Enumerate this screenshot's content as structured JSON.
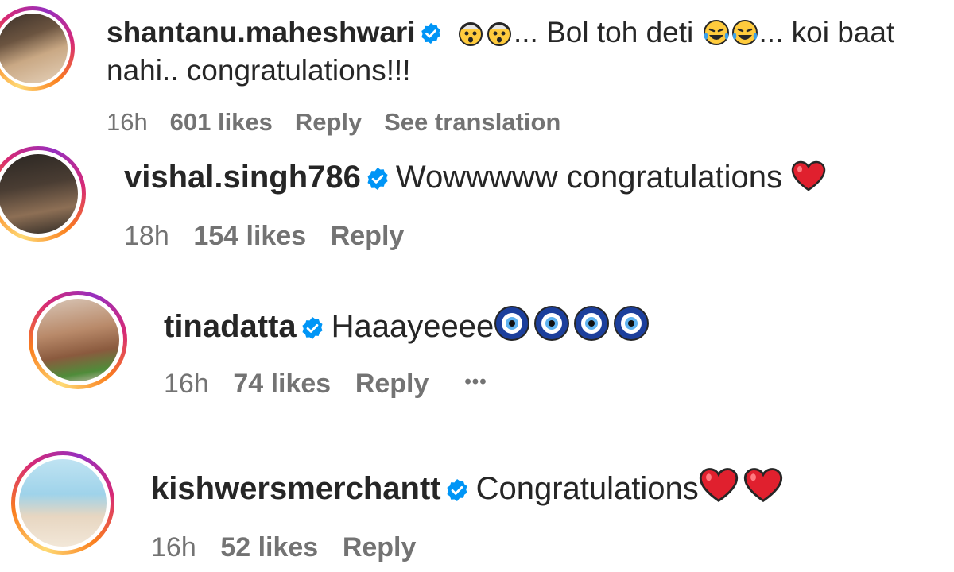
{
  "comments": [
    {
      "username": "shantanu.maheshwari",
      "text_parts": [
        "... Bol toh deti ",
        "... koi baat"
      ],
      "text_line2": "nahi.. congratulations!!!",
      "time": "16h",
      "likes": "601 likes",
      "reply": "Reply",
      "translate": "See translation"
    },
    {
      "username": "vishal.singh786",
      "text": "Wowwwww congratulations ",
      "time": "18h",
      "likes": "154 likes",
      "reply": "Reply"
    },
    {
      "username": "tinadatta",
      "text": "Haaayeeee",
      "time": "16h",
      "likes": "74 likes",
      "reply": "Reply",
      "more": "•••"
    },
    {
      "username": "kishwersmerchantt",
      "text": "Congratulations",
      "time": "16h",
      "likes": "52 likes",
      "reply": "Reply"
    }
  ],
  "icons": {
    "verified": "verified-badge-icon",
    "shocked": "exploding-head-emoji",
    "laughing": "tears-of-joy-emoji",
    "heart": "red-heart-emoji",
    "nazar": "nazar-amulet-emoji"
  },
  "colors": {
    "verified": "#0095f6",
    "meta": "#737373",
    "heart": "#e0202e",
    "nazar": "#1c3f9c"
  }
}
